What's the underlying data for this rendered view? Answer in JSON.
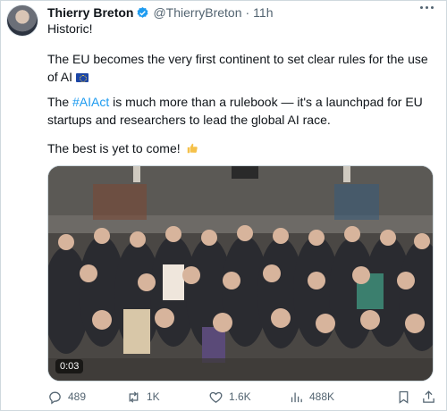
{
  "author": {
    "name": "Thierry Breton",
    "handle": "@ThierryBreton",
    "separator": "·",
    "time": "11h",
    "verified_icon": "verified-badge-icon"
  },
  "tweet": {
    "line1": "Historic!",
    "line2": "The EU becomes the very first continent to set clear rules for the use of AI",
    "line3_prefix": "The ",
    "hashtag": "#AIAct",
    "line3_suffix": " is much more than a rulebook — it's a launchpad for EU startups and researchers to lead the global AI race.",
    "line4": "The best is yet to come!",
    "emoji": [
      "eu-flag-icon",
      "thumbs-up-icon"
    ]
  },
  "media": {
    "duration": "0:03"
  },
  "actions": {
    "replies": "489",
    "retweets": "1K",
    "likes": "1.6K",
    "views": "488K"
  },
  "colors": {
    "accent": "#1d9bf0",
    "secondary_text": "#536471",
    "border": "#cfd9de"
  }
}
